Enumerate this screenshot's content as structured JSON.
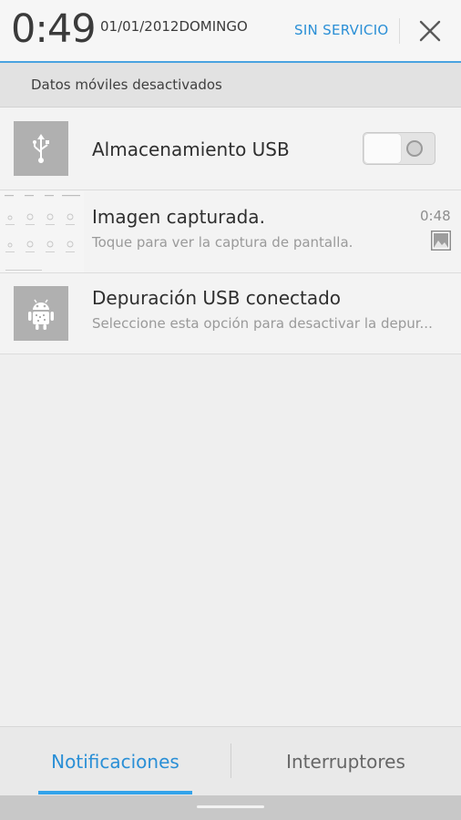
{
  "status_header": {
    "time": "0:49",
    "date": "01/01/2012DOMINGO",
    "carrier": "SIN SERVICIO",
    "close_icon": "close-icon"
  },
  "mobile_data": {
    "label": "Datos móviles desactivados"
  },
  "notifications": [
    {
      "title": "Almacenamiento USB",
      "icon": "usb-icon",
      "toggle_on": false
    },
    {
      "title": "Imagen capturada.",
      "subtitle": "Toque para ver la captura de pantalla.",
      "time": "0:48",
      "icon": "screenshot-thumbnail",
      "badge_icon": "image-icon"
    },
    {
      "title": "Depuración USB conectado",
      "subtitle": "Seleccione esta opción para desactivar la depur...",
      "icon": "android-debug-icon"
    }
  ],
  "tabs": {
    "notifications": "Notificaciones",
    "switches": "Interruptores",
    "active": "notifications"
  },
  "colors": {
    "accent": "#2a8fd6",
    "background": "#efefef",
    "icon_background": "#b0b0b0"
  }
}
